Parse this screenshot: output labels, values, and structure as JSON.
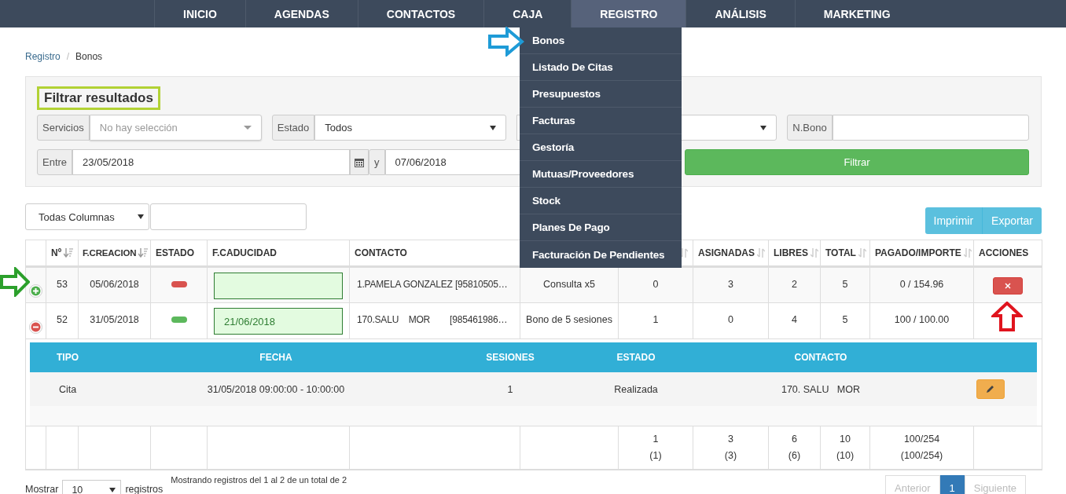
{
  "nav": {
    "items": [
      {
        "label": "INICIO",
        "selected": false
      },
      {
        "label": "AGENDAS",
        "selected": false
      },
      {
        "label": "CONTACTOS",
        "selected": false
      },
      {
        "label": "CAJA",
        "selected": false
      },
      {
        "label": "REGISTRO",
        "selected": true
      },
      {
        "label": "ANÁLISIS",
        "selected": false
      },
      {
        "label": "MARKETING",
        "selected": false
      }
    ]
  },
  "menu": {
    "items": [
      "Bonos",
      "Listado De Citas",
      "Presupuestos",
      "Facturas",
      "Gestoría",
      "Mutuas/Proveedores",
      "Stock",
      "Planes De Pago",
      "Facturación De Pendientes"
    ]
  },
  "breadcrumb": [
    {
      "label": "Registro",
      "kind": "link"
    },
    {
      "label": "Bonos",
      "kind": "current",
      "separator": "/"
    }
  ],
  "filter": {
    "title": "Filtrar resultados",
    "fields": [
      {
        "kind": "multiselect",
        "label": "Servicios",
        "placeholder": "No hay selección"
      },
      {
        "kind": "select",
        "label": "Estado",
        "value": "Todos"
      },
      {
        "kind": "select"
      },
      {
        "kind": "text",
        "label": "N.Bono"
      }
    ],
    "date_range": {
      "label": "Entre",
      "from": "23/05/2018",
      "separator": "y",
      "to": "07/06/2018"
    },
    "button": "Filtrar"
  },
  "search": {
    "column_select": "Todas Columnas"
  },
  "buttons": [
    "Imprimir",
    "Exportar"
  ],
  "table": {
    "columns": [
      {},
      {
        "label": "Nº",
        "sorted": true
      },
      {
        "label": "F.CREACION",
        "sorted": true
      },
      {
        "label": "ESTADO"
      },
      {
        "label": "F.CADUCIDAD"
      },
      {
        "label": "CONTACTO"
      },
      {},
      {
        "sorted": false
      },
      {
        "label": "ASIGNADAS",
        "sorted": false
      },
      {
        "label": "LIBRES",
        "sorted": false
      },
      {
        "label": "TOTAL",
        "sorted": false
      },
      {
        "label": "PAGADO/IMPORTE",
        "sorted": false
      },
      {
        "label": "ACCIONES"
      }
    ],
    "rows": [
      {
        "cells": [
          {
            "kind": "toggle",
            "expanded": false
          },
          {
            "kind": "text",
            "text": "53"
          },
          {
            "kind": "text",
            "text": "05/06/2018"
          },
          {
            "kind": "status",
            "color": "#d9534f"
          },
          {
            "kind": "date_input"
          },
          {
            "kind": "contact",
            "text": "1.PAMELA GONZALEZ [95810505…"
          },
          {
            "kind": "text",
            "text": "Consulta x5"
          },
          {
            "kind": "text",
            "text": "0"
          },
          {
            "kind": "text",
            "text": "3"
          },
          {
            "kind": "text",
            "text": "2"
          },
          {
            "kind": "text",
            "text": "5"
          },
          {
            "kind": "text",
            "text": "0 / 154.96"
          },
          {
            "kind": "actions",
            "deletable": true
          }
        ]
      },
      {
        "cells": [
          {
            "kind": "toggle",
            "expanded": true
          },
          {
            "kind": "text",
            "text": "52"
          },
          {
            "kind": "text",
            "text": "31/05/2018"
          },
          {
            "kind": "status",
            "color": "#5cb85c"
          },
          {
            "kind": "date_input",
            "value": "21/06/2018"
          },
          {
            "kind": "contact",
            "text": "170.SALU    MOR        [985461986…"
          },
          {
            "kind": "text",
            "text": "Bono de 5 sesiones"
          },
          {
            "kind": "text",
            "text": "1"
          },
          {
            "kind": "text",
            "text": "0"
          },
          {
            "kind": "text",
            "text": "4"
          },
          {
            "kind": "text",
            "text": "5"
          },
          {
            "kind": "text",
            "text": "100 / 100.00"
          },
          {
            "kind": "actions",
            "deletable": false
          }
        ],
        "detail": {
          "columns": [
            "TIPO",
            "FECHA",
            "SESIONES",
            "ESTADO",
            "CONTACTO"
          ],
          "rows": [
            {
              "cells": [
                "Cita",
                "31/05/2018 09:00:00 - 10:00:00",
                "1",
                "Realizada",
                "170. SALU   MOR"
              ],
              "editable": true
            }
          ]
        }
      }
    ],
    "totals": [
      {
        "kind": "empty"
      },
      {
        "kind": "empty"
      },
      {
        "kind": "empty"
      },
      {
        "kind": "empty"
      },
      {
        "kind": "empty"
      },
      {
        "kind": "empty"
      },
      {
        "kind": "empty"
      },
      {
        "kind": "total",
        "value": "1",
        "sub": "(1)"
      },
      {
        "kind": "total",
        "value": "3",
        "sub": "(3)"
      },
      {
        "kind": "total",
        "value": "6",
        "sub": "(6)"
      },
      {
        "kind": "total",
        "value": "10",
        "sub": "(10)"
      },
      {
        "kind": "total",
        "value": "100/254",
        "sub": "(100/254)"
      },
      {
        "kind": "empty"
      }
    ]
  },
  "footer": {
    "show_label": "Mostrar",
    "page_size": "10",
    "records_label": "registros",
    "info": "Mostrando registros del 1 al 2 de un total de 2",
    "pagination": [
      {
        "label": "Anterior",
        "selected": false,
        "disabled": true
      },
      {
        "label": "1",
        "selected": true,
        "disabled": false
      },
      {
        "label": "Siguiente",
        "selected": false,
        "disabled": true
      }
    ]
  }
}
